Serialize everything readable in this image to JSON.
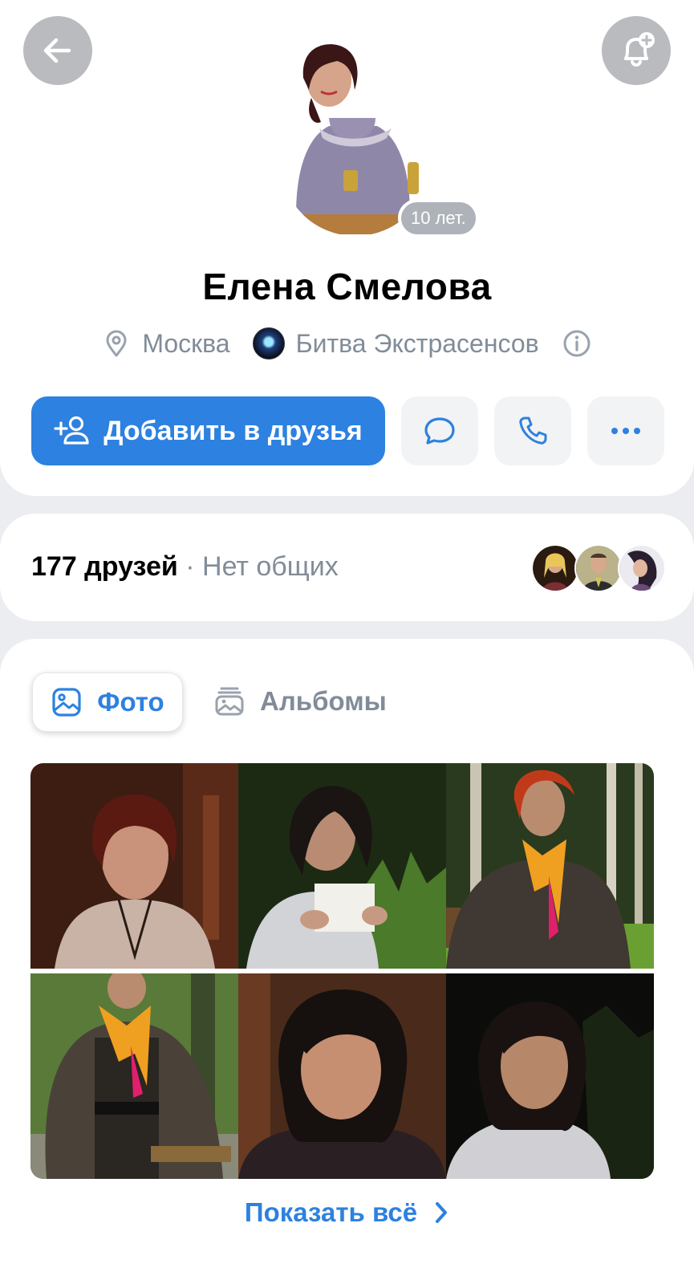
{
  "header": {
    "back_icon": "arrow-left-icon",
    "notify_icon": "bell-plus-icon"
  },
  "profile": {
    "name": "Елена Смелова",
    "age_badge": "10 лет.",
    "city": "Москва",
    "community": "Битва Экстрасенсов",
    "location_icon": "map-pin-icon",
    "info_icon": "info-circle-icon"
  },
  "actions": {
    "add_friend_label": "Добавить в друзья",
    "add_friend_icon": "user-plus-icon",
    "message_icon": "message-bubble-icon",
    "call_icon": "phone-icon",
    "more_icon": "more-dots-icon"
  },
  "friends": {
    "count_label": "177 друзей",
    "separator": "·",
    "mutual_label": "Нет общих"
  },
  "media": {
    "tabs": [
      {
        "label": "Фото",
        "icon": "photo-icon",
        "active": true
      },
      {
        "label": "Альбомы",
        "icon": "albums-icon",
        "active": false
      }
    ],
    "show_all_label": "Показать всё"
  },
  "colors": {
    "accent": "#2d81e0",
    "secondary_text": "#818c99",
    "background": "#ebedf0",
    "header_button": "#b9bbbf"
  }
}
